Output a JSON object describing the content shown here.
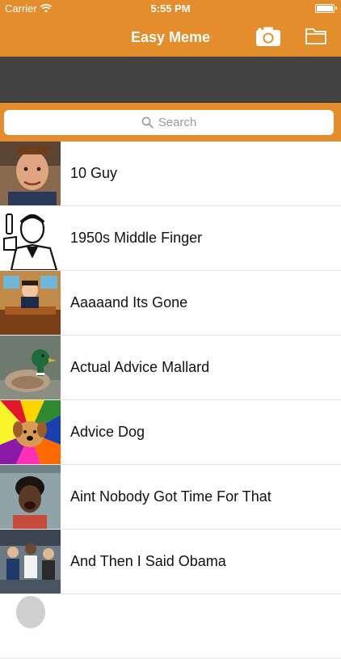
{
  "status": {
    "carrier": "Carrier",
    "time": "5:55 PM"
  },
  "nav": {
    "title": "Easy Meme",
    "camera_icon": "camera-icon",
    "folder_icon": "folder-icon"
  },
  "search": {
    "placeholder": "Search",
    "icon": "search-icon"
  },
  "colors": {
    "accent": "#e38d2c",
    "dark": "#434343"
  },
  "memes": [
    {
      "label": "10 Guy"
    },
    {
      "label": "1950s Middle Finger"
    },
    {
      "label": "Aaaaand Its Gone"
    },
    {
      "label": "Actual Advice Mallard"
    },
    {
      "label": "Advice Dog"
    },
    {
      "label": "Aint Nobody Got Time For That"
    },
    {
      "label": "And Then I Said Obama"
    }
  ]
}
